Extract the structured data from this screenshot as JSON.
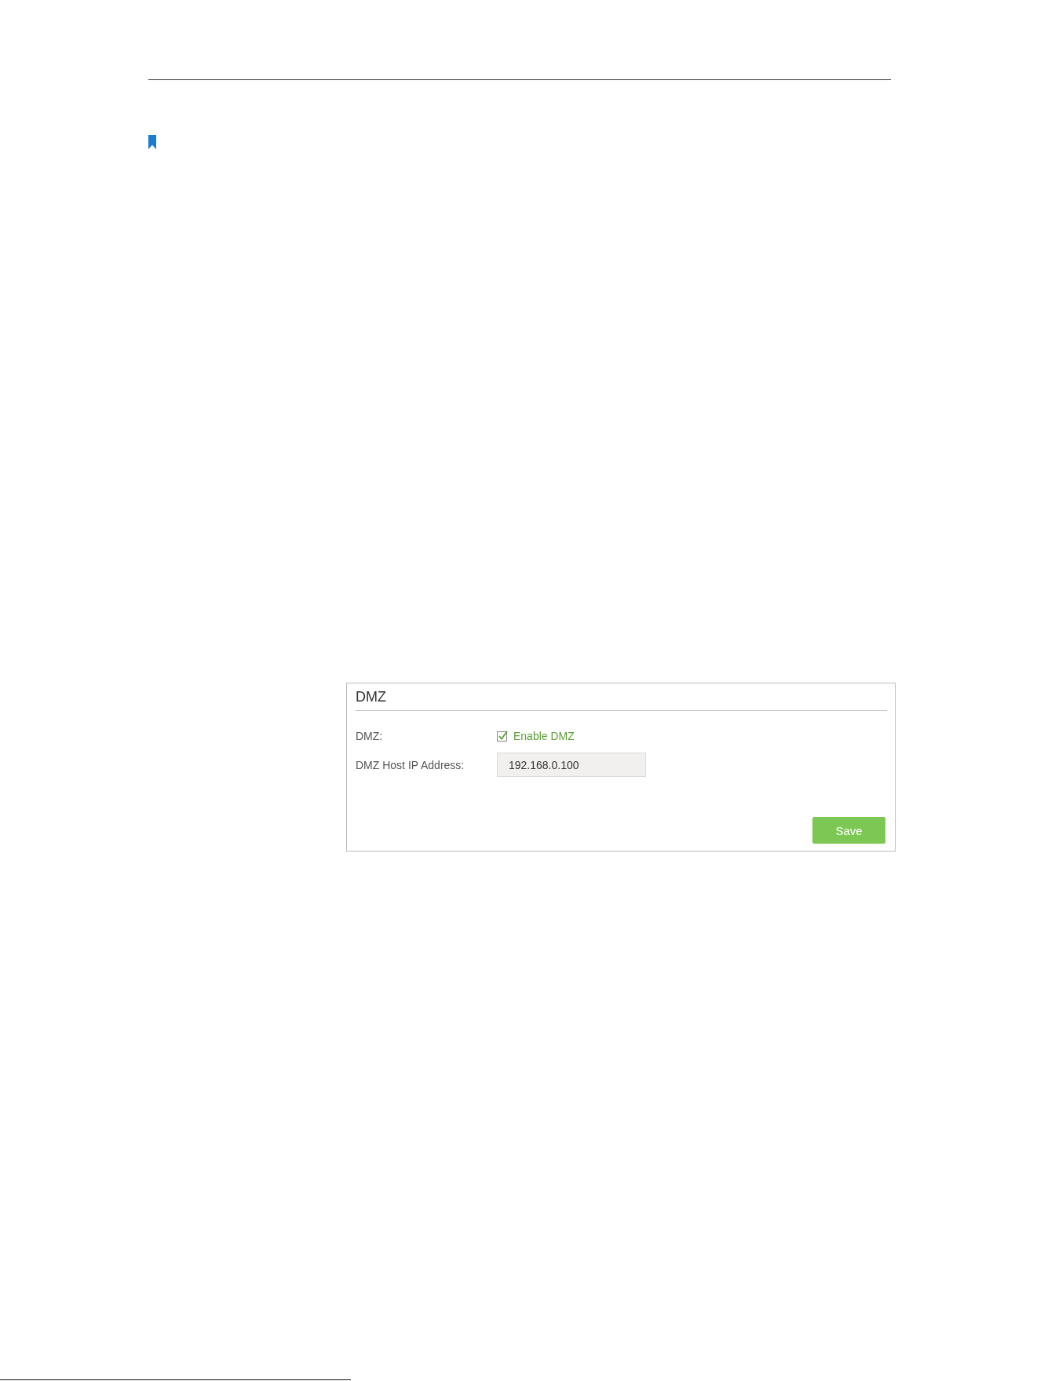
{
  "panel": {
    "title": "DMZ",
    "fields": [
      {
        "kind": "checkbox",
        "label": "DMZ:",
        "option": "Enable DMZ",
        "checked": true
      },
      {
        "kind": "text",
        "label": "DMZ Host IP Address:",
        "value": "192.168.0.100"
      }
    ],
    "buttons": [
      "Save"
    ]
  }
}
